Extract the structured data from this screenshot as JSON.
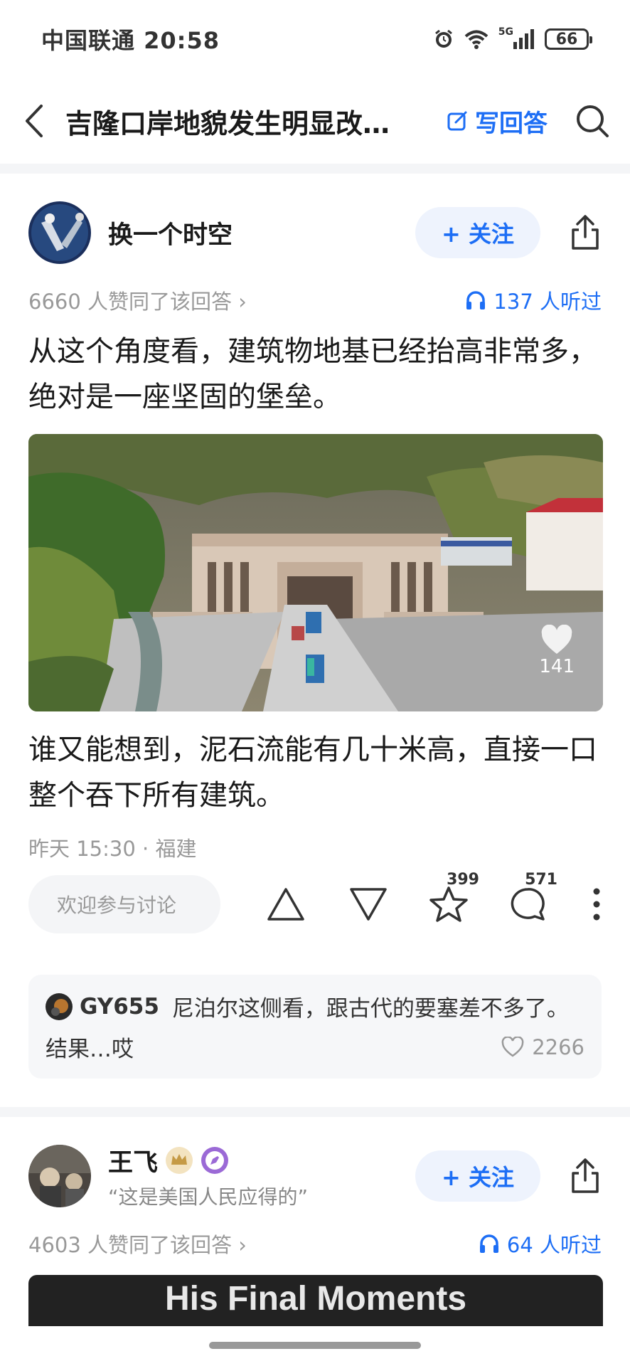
{
  "status_bar": {
    "carrier_time": "中国联通 20:58",
    "network": "5G",
    "battery": "66",
    "icons": [
      "alarm-icon",
      "wifi-icon",
      "signal-icon",
      "battery-icon"
    ]
  },
  "nav": {
    "title": "吉隆口岸地貌发生明显改变...",
    "write_answer": "写回答",
    "icons": [
      "back-icon",
      "edit-icon",
      "search-icon"
    ]
  },
  "answer1": {
    "author": "换一个时空",
    "follow": "+ 关注",
    "agree": "6660 人赞同了该回答 ›",
    "listens": "137 人听过",
    "text1": "从这个角度看，建筑物地基已经抬高非常多，绝对是一座坚固的堡垒。",
    "image_likes": "141",
    "text2": "谁又能想到，泥石流能有几十米高，直接一口整个吞下所有建筑。",
    "time_location": "昨天 15:30 · 福建",
    "comment_placeholder": "欢迎参与讨论",
    "favorites": "399",
    "comments": "571",
    "hot_comment": {
      "user": "GY655",
      "text_line1": "尼泊尔这侧看，跟古代的要塞差不多了。",
      "text_line2": "结果…哎",
      "likes": "2266"
    }
  },
  "answer2": {
    "author": "王飞",
    "quote": "“这是美国人民应得的”",
    "follow": "+ 关注",
    "agree": "4603 人赞同了该回答 ›",
    "listens": "64 人听过",
    "video_title": "His Final Moments"
  },
  "colors": {
    "accent": "#1d6ef5",
    "muted": "#999999",
    "text": "#1a1a1a"
  }
}
